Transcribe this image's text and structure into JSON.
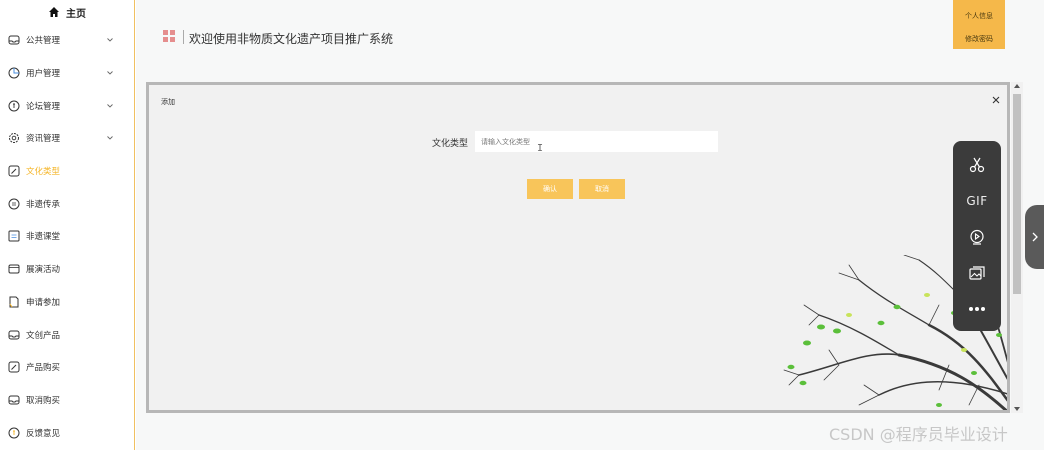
{
  "sidebar": {
    "home_label": "主页",
    "items": [
      {
        "label": "公共管理",
        "icon": "inbox-icon",
        "has_arrow": true
      },
      {
        "label": "用户管理",
        "icon": "pie-chart-icon",
        "has_arrow": true
      },
      {
        "label": "论坛管理",
        "icon": "circle-dollar-icon",
        "has_arrow": true
      },
      {
        "label": "资讯管理",
        "icon": "gear-icon",
        "has_arrow": true
      },
      {
        "label": "文化类型",
        "icon": "edit-icon",
        "has_arrow": false,
        "active": true
      },
      {
        "label": "非遗传承",
        "icon": "circle-list-icon",
        "has_arrow": false
      },
      {
        "label": "非遗课堂",
        "icon": "square-list-icon",
        "has_arrow": false
      },
      {
        "label": "展演活动",
        "icon": "window-icon",
        "has_arrow": false
      },
      {
        "label": "申请参加",
        "icon": "document-icon",
        "has_arrow": false
      },
      {
        "label": "文创产品",
        "icon": "inbox-icon",
        "has_arrow": false
      },
      {
        "label": "产品购买",
        "icon": "edit-icon",
        "has_arrow": false
      },
      {
        "label": "取消购买",
        "icon": "inbox-icon",
        "has_arrow": false
      },
      {
        "label": "反馈意见",
        "icon": "circle-dollar-icon",
        "has_arrow": false
      }
    ]
  },
  "header": {
    "title": "欢迎使用非物质文化遗产项目推广系统",
    "user_menu": {
      "profile": "个人信息",
      "change_password": "修改密码"
    }
  },
  "dialog": {
    "title": "添加",
    "form": {
      "label": "文化类型",
      "placeholder": "请输入文化类型",
      "value": ""
    },
    "confirm_label": "确认",
    "cancel_label": "取消"
  },
  "float_toolbar": {
    "gif_label": "GIF",
    "items": [
      "scissors-icon",
      "gif-icon",
      "record-icon",
      "gallery-icon",
      "more-icon"
    ]
  },
  "watermark": "CSDN @程序员毕业设计",
  "colors": {
    "accent": "#f5b62a",
    "button": "#f8c55a",
    "toolbar": "#3b3b3b"
  }
}
